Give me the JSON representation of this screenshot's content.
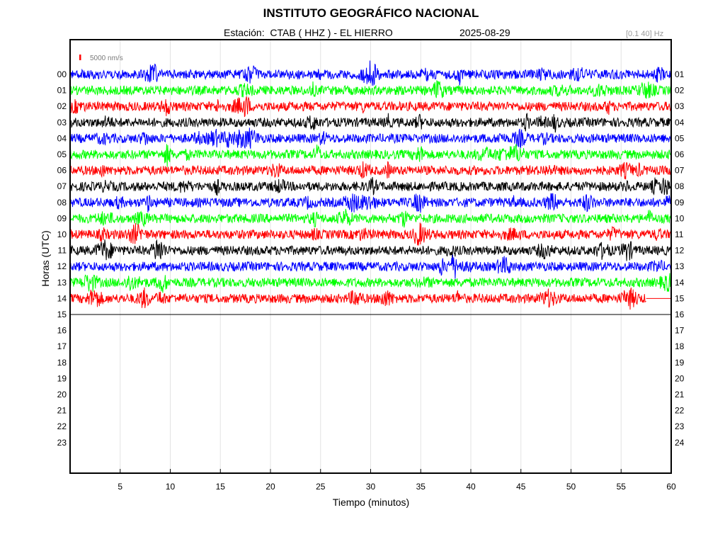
{
  "header": {
    "title": "INSTITUTO GEOGRÁFICO NACIONAL",
    "station_label": "Estación:  CTAB ( HHZ ) - EL HIERRO",
    "date": "2025-08-29",
    "filter": "[0.1 40] Hz"
  },
  "chart_data": {
    "type": "line",
    "title": "INSTITUTO GEOGRÁFICO NACIONAL",
    "xlabel": "Tiempo (minutos)",
    "ylabel": "Horas (UTC)",
    "xlim": [
      0,
      60
    ],
    "x_ticks": [
      "5",
      "10",
      "15",
      "20",
      "25",
      "30",
      "35",
      "40",
      "45",
      "50",
      "55",
      "60"
    ],
    "y_labels_left": [
      "00",
      "01",
      "02",
      "03",
      "04",
      "05",
      "06",
      "07",
      "08",
      "09",
      "10",
      "11",
      "12",
      "13",
      "14",
      "15",
      "16",
      "17",
      "18",
      "19",
      "20",
      "21",
      "22",
      "23"
    ],
    "y_labels_right": [
      "01",
      "02",
      "03",
      "04",
      "05",
      "06",
      "07",
      "08",
      "09",
      "10",
      "11",
      "12",
      "13",
      "14",
      "15",
      "16",
      "17",
      "18",
      "19",
      "20",
      "21",
      "22",
      "23",
      "24"
    ],
    "scale_bar": "5000 nm/s",
    "grid": "vertical",
    "color_cycle": [
      "#0000ff",
      "#00ff00",
      "#ff0000",
      "#000000"
    ],
    "series": [
      {
        "hour": "00",
        "color": "#0000ff",
        "end_minute": 60
      },
      {
        "hour": "01",
        "color": "#00ff00",
        "end_minute": 60
      },
      {
        "hour": "02",
        "color": "#ff0000",
        "end_minute": 60
      },
      {
        "hour": "03",
        "color": "#000000",
        "end_minute": 60
      },
      {
        "hour": "04",
        "color": "#0000ff",
        "end_minute": 60
      },
      {
        "hour": "05",
        "color": "#00ff00",
        "end_minute": 60
      },
      {
        "hour": "06",
        "color": "#ff0000",
        "end_minute": 60
      },
      {
        "hour": "07",
        "color": "#000000",
        "end_minute": 60
      },
      {
        "hour": "08",
        "color": "#0000ff",
        "end_minute": 60
      },
      {
        "hour": "09",
        "color": "#00ff00",
        "end_minute": 60
      },
      {
        "hour": "10",
        "color": "#ff0000",
        "end_minute": 60
      },
      {
        "hour": "11",
        "color": "#000000",
        "end_minute": 60
      },
      {
        "hour": "12",
        "color": "#0000ff",
        "end_minute": 60
      },
      {
        "hour": "13",
        "color": "#00ff00",
        "end_minute": 60
      },
      {
        "hour": "14",
        "color": "#ff0000",
        "end_minute": 57.5
      },
      {
        "hour": "15",
        "color": "#000000",
        "end_minute": 0
      }
    ]
  }
}
